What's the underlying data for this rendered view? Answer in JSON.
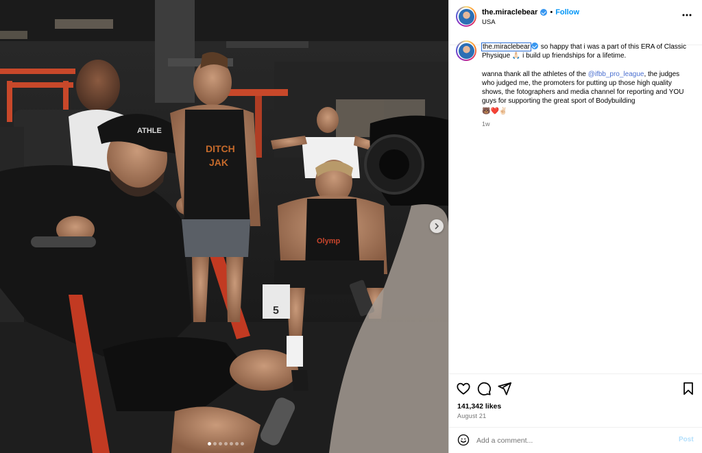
{
  "post": {
    "username": "the.miraclebear",
    "follow_label": "Follow",
    "separator": "•",
    "location": "USA",
    "caption": {
      "username": "the.miraclebear",
      "line1": " so happy that i was a part of this ERA of Classic Physique 🙏🏻 i build up friendships for a lifetime.",
      "line2_before": "wanna thank all the athletes of the ",
      "mention": "@ifbb_pro_league",
      "line2_after": ", the judges who judged me, the promoters for putting up those high quality shows, the fotographers and media channel for reporting and YOU guys for supporting the great sport of Bodybuilding",
      "emojis": "🐻❤️✌🏻"
    },
    "time_ago": "1w",
    "likes": "141,342 likes",
    "date": "August 21"
  },
  "comment": {
    "placeholder": "Add a comment...",
    "post_label": "Post"
  },
  "carousel": {
    "total": 7,
    "active_index": 0
  },
  "icons": {
    "more": "more-options-icon",
    "like": "heart-icon",
    "comment": "comment-icon",
    "share": "paper-plane-icon",
    "save": "bookmark-icon",
    "emoji": "emoji-smile-icon",
    "next": "chevron-right-icon"
  },
  "colors": {
    "verified": "#3897f0",
    "follow": "#0095f6",
    "mention": "#4a6fd0",
    "post_disabled": "#b2dffc",
    "meta_text": "#737373"
  }
}
